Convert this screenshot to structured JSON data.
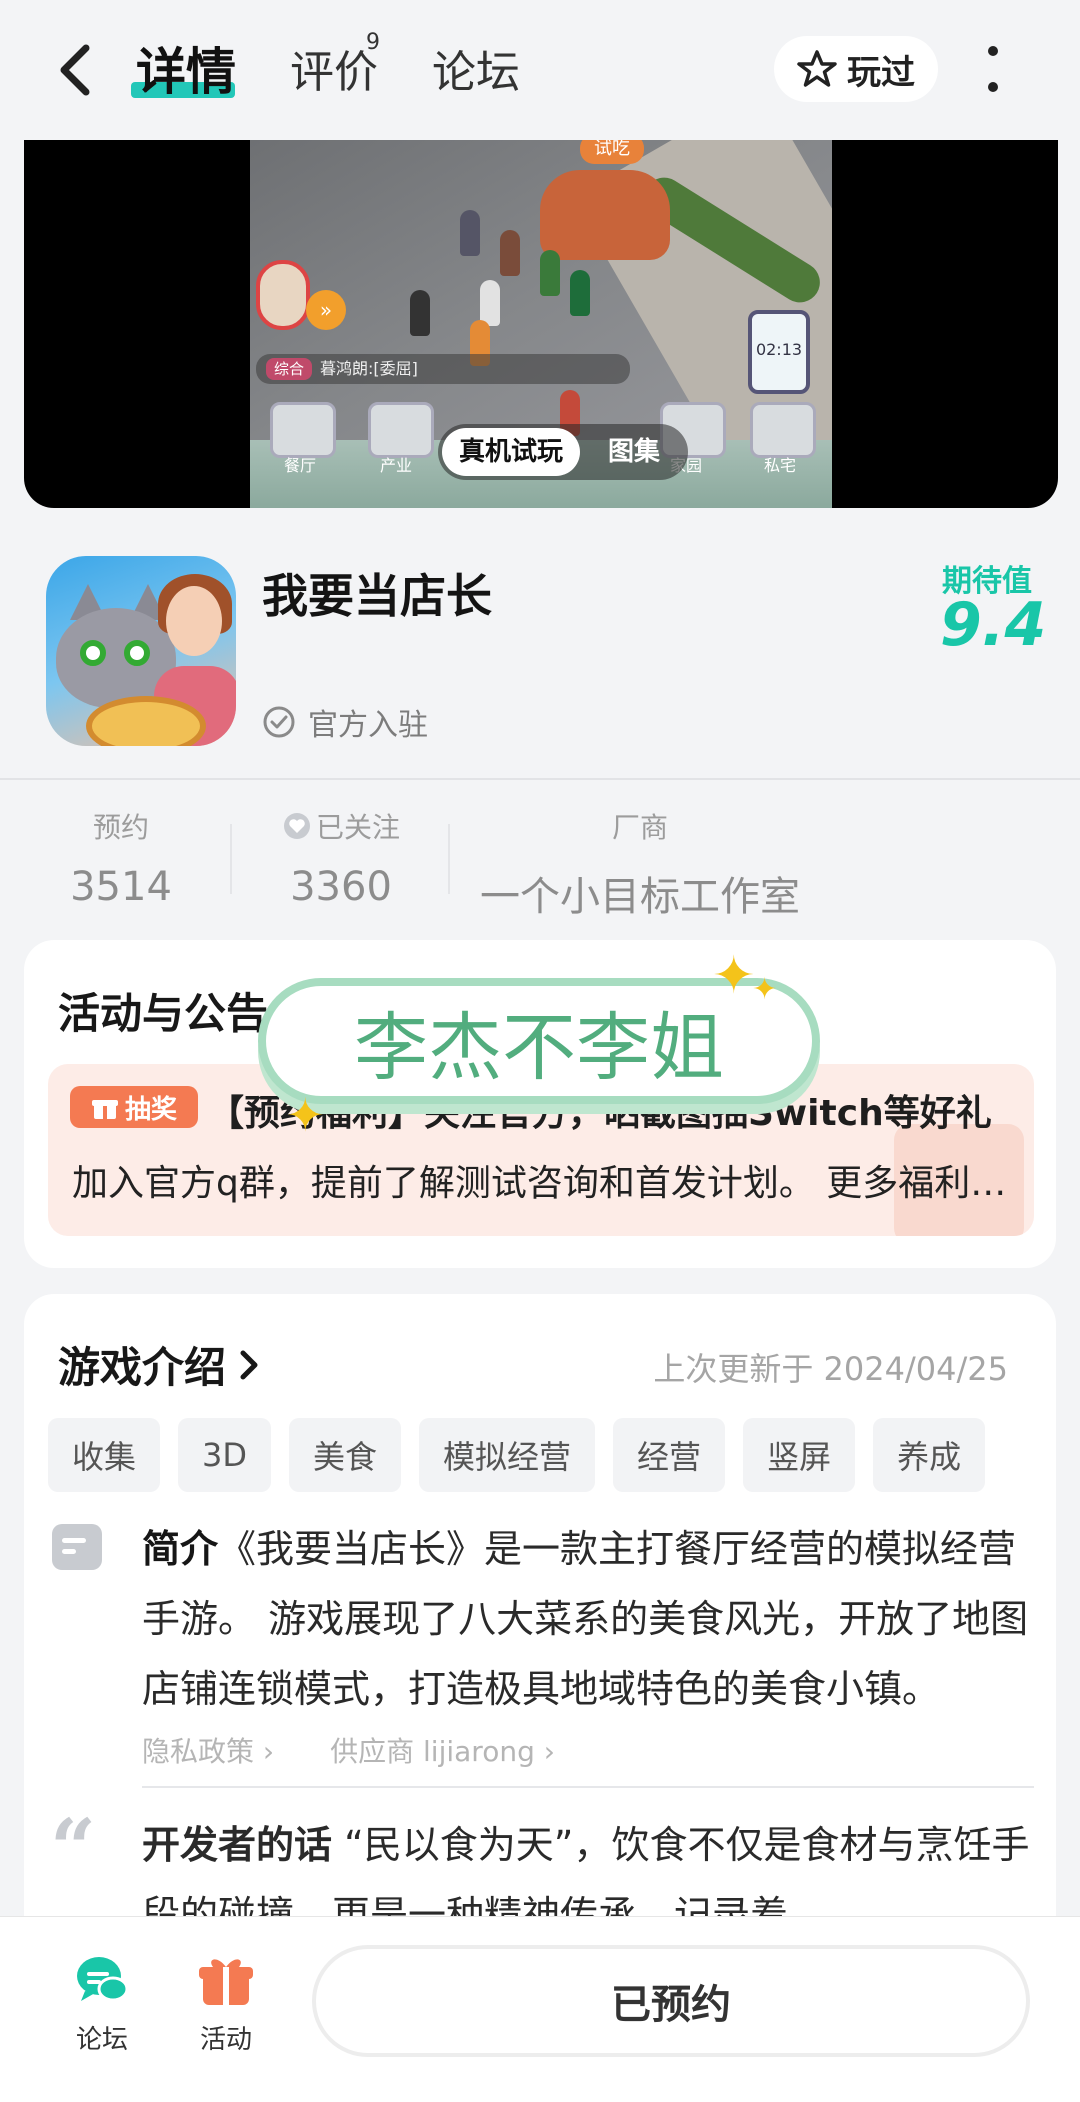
{
  "header": {
    "tabs": [
      {
        "label": "详情",
        "active": true
      },
      {
        "label": "评价",
        "badge": "9"
      },
      {
        "label": "论坛"
      }
    ],
    "played_label": "玩过"
  },
  "media": {
    "tabs": [
      "真机试玩",
      "图集"
    ],
    "screen": {
      "bus_sign": "试吃",
      "chat_tag": "综合",
      "chat_text": "暮鸿朗:[委屈]",
      "clock": "02:13",
      "icon_labels": [
        "餐厅",
        "产业",
        "家园",
        "私宅"
      ]
    }
  },
  "game": {
    "title": "我要当店长",
    "official_label": "官方入驻",
    "expect_label": "期待值",
    "expect_value": "9.4"
  },
  "stats": [
    {
      "label": "预约",
      "value": "3514"
    },
    {
      "label": "已关注",
      "value": "3360"
    },
    {
      "label": "厂商",
      "value": "一个小目标工作室"
    }
  ],
  "activity": {
    "title": "活动与公告",
    "tag": "抽奖",
    "headline": "【预约福利】关注官方，晒截图抽Switch等好礼",
    "description": "加入官方q群，提前了解测试咨询和首发计划。 更多福利等你来拿"
  },
  "watermark_text": "李杰不李姐",
  "intro": {
    "title": "游戏介绍",
    "updated": "上次更新于 2024/04/25",
    "tags": [
      "收集",
      "3D",
      "美食",
      "模拟经营",
      "经营",
      "竖屏",
      "养成"
    ],
    "summary_label": "简介",
    "summary": "《我要当店长》是一款主打餐厅经营的模拟经营手游。 游戏展现了八大菜系的美食风光，开放了地图店铺连锁模式，打造极具地域特色的美食小镇。",
    "privacy_link": "隐私政策",
    "supplier_link": "供应商 lijiarong",
    "dev_label": "开发者的话",
    "dev_text": "“民以食为天”，饮食不仅是食材与烹饪手段的碰撞，更是一种精神传承，记录着"
  },
  "bottom": {
    "forum_label": "论坛",
    "activity_label": "活动",
    "reserve_label": "已预约"
  },
  "colors": {
    "accent": "#19c6a8",
    "lottery": "#f47a52"
  }
}
